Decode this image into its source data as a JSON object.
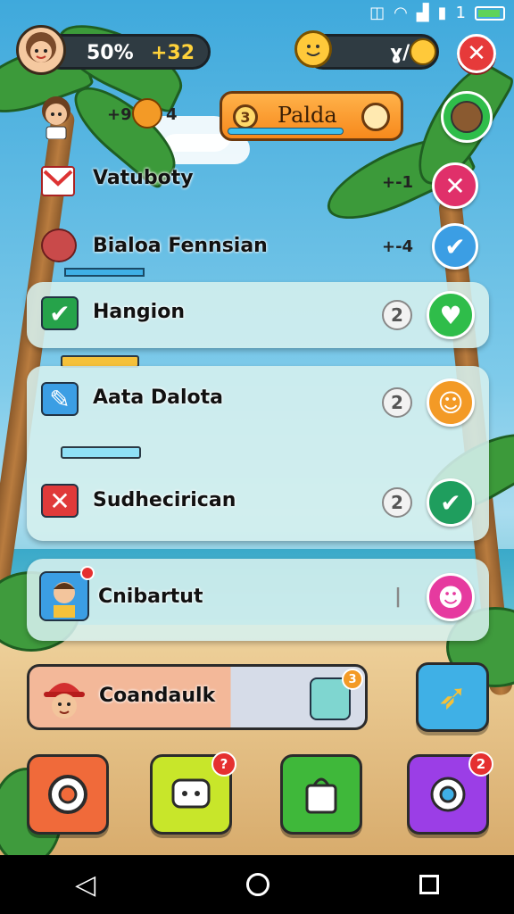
{
  "status_bar": {
    "signal_text": "1"
  },
  "header": {
    "percent": "50%",
    "coins": "+32",
    "right_value": "ɣ/",
    "banner_label": "Palda",
    "banner_num": "3",
    "mini_score": "+9",
    "mini_score_right": "4"
  },
  "rows": [
    {
      "label": "Vatuboty",
      "count": "+-1"
    },
    {
      "label": "Bialoa Fennsian",
      "count": "+-4"
    }
  ],
  "panel_rows": [
    {
      "label": "Hangion",
      "badge": "2"
    },
    {
      "label": "Aata Dalota",
      "badge": "2"
    },
    {
      "label": "Sudhecirican",
      "badge": "2"
    }
  ],
  "single_row": {
    "label": "Cnibartut",
    "badge": "|"
  },
  "feature_row": {
    "label": "Coandaulk",
    "notif": "3"
  },
  "bottom_buttons": [
    {
      "name": "settings",
      "notif": ""
    },
    {
      "name": "chat",
      "notif": "?"
    },
    {
      "name": "shop",
      "notif": ""
    },
    {
      "name": "gear",
      "notif": "2"
    }
  ],
  "colors": {
    "close": "#e63a3a",
    "confirm": "#2fbd4a",
    "blue": "#3b9ee4",
    "orange": "#f39a26",
    "pink": "#e63a9f",
    "purple": "#9b3ee6"
  }
}
